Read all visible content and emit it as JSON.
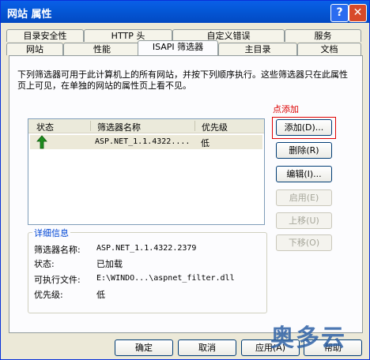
{
  "window": {
    "title": "网站 属性",
    "help": "?",
    "close": "✕"
  },
  "tabs_row1": [
    "目录安全性",
    "HTTP 头",
    "自定义错误",
    "服务"
  ],
  "tabs_row2": [
    "网站",
    "性能",
    "ISAPI 筛选器",
    "主目录",
    "文档"
  ],
  "active_tab": "ISAPI 筛选器",
  "description": "下列筛选器可用于此计算机上的所有网站，并按下列顺序执行。这些筛选器只在此属性页上可见，在单独的网站的属性页上看不见。",
  "hint": "点添加",
  "list": {
    "headers": [
      "状态",
      "筛选器名称",
      "优先级"
    ],
    "rows": [
      {
        "status_icon": "green-up-arrow-icon",
        "name": "ASP.NET_1.1.4322....",
        "priority": "低"
      }
    ]
  },
  "side_buttons": {
    "add": "添加(D)...",
    "remove": "删除(R)",
    "edit": "编辑(I)...",
    "enable": "启用(E)",
    "move_up": "上移(U)",
    "move_down": "下移(O)"
  },
  "details": {
    "group_label": "详细信息",
    "labels": [
      "筛选器名称:",
      "状态:",
      "可执行文件:",
      "优先级:"
    ],
    "name": "ASP.NET_1.1.4322.2379",
    "status": "已加载",
    "executable": "E:\\WINDO...\\aspnet_filter.dll",
    "priority": "低"
  },
  "bottom_buttons": {
    "ok": "确定",
    "cancel": "取消",
    "apply": "应用(A)",
    "help": "帮助"
  },
  "watermark": "奥多云",
  "colors": {
    "titlebar": "#0458D8",
    "highlight": "#E00000",
    "hint_text": "#DD0000",
    "group_label": "#0046D5"
  }
}
